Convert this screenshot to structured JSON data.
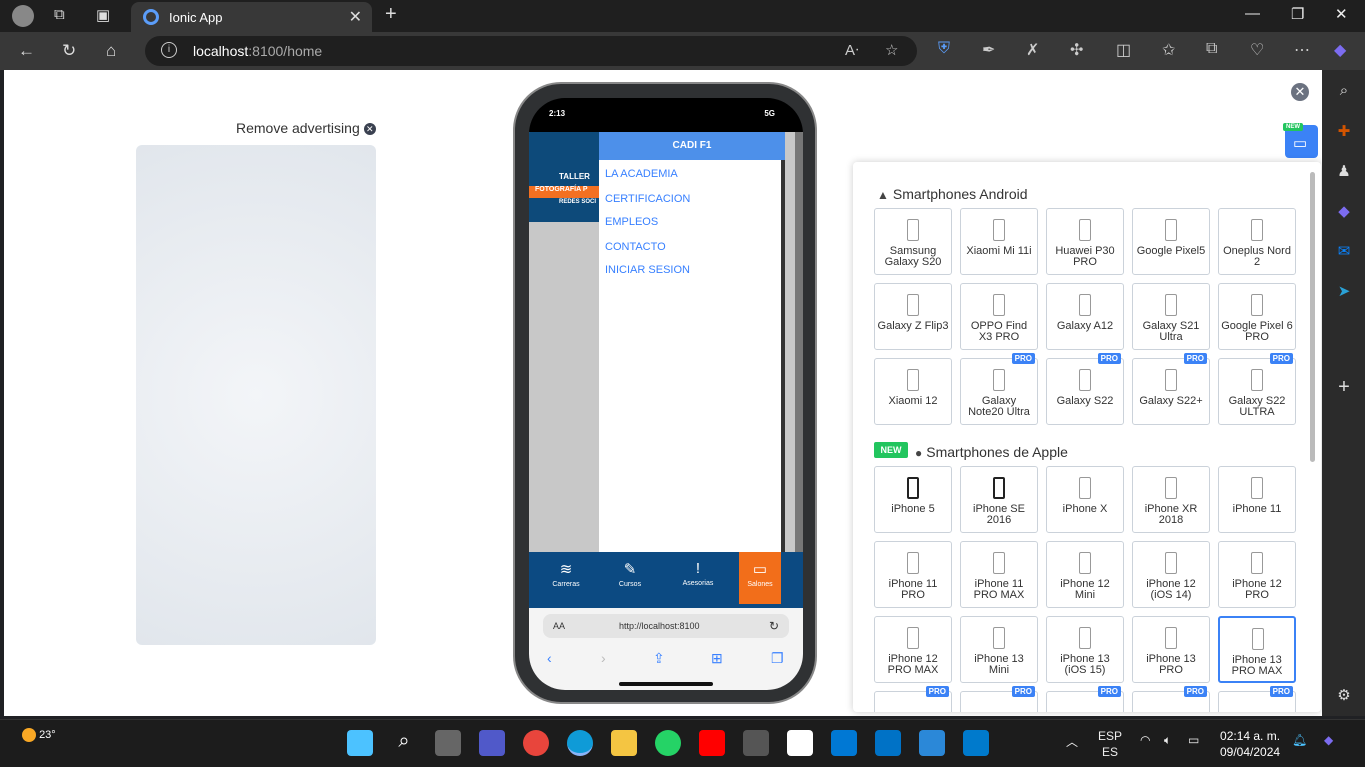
{
  "browser": {
    "tab_title": "Ionic App",
    "url_host": "localhost",
    "url_rest": ":8100/home"
  },
  "ad": {
    "remove_label": "Remove advertising",
    "close_glyph": "✕"
  },
  "phone": {
    "time": "2:13",
    "signal": "5G",
    "banner_text_1": "TALLER",
    "banner_text_2": "FOTOGRAFÍA P",
    "banner_text_3": "REDES SOCI",
    "menu_title": "CADI F1",
    "menu_items": [
      "LA ACADEMIA",
      "CERTIFICACION",
      "EMPLEOS",
      "CONTACTO",
      "INICIAR SESION"
    ],
    "tabs": [
      {
        "label": "Carreras",
        "icon": "≋"
      },
      {
        "label": "Cursos",
        "icon": "✎"
      },
      {
        "label": "Asesorias",
        "icon": "!"
      },
      {
        "label": "Salones",
        "icon": "▭"
      }
    ],
    "safari_aa": "AA",
    "safari_url": "http://localhost:8100"
  },
  "panel": {
    "android_header": "Smartphones Android",
    "apple_header": "Smartphones de Apple",
    "new_badge": "NEW",
    "pro_badge": "PRO",
    "android_devices": [
      "Samsung Galaxy S20",
      "Xiaomi Mi 11i",
      "Huawei P30 PRO",
      "Google Pixel5",
      "Oneplus Nord 2",
      "Galaxy Z Flip3",
      "OPPO Find X3 PRO",
      "Galaxy A12",
      "Galaxy S21 Ultra",
      "Google Pixel 6 PRO",
      "Xiaomi 12",
      "Galaxy Note20 Ultra",
      "Galaxy S22",
      "Galaxy S22+",
      "Galaxy S22 ULTRA"
    ],
    "apple_devices": [
      "iPhone 5",
      "iPhone SE 2016",
      "iPhone X",
      "iPhone XR 2018",
      "iPhone 11",
      "iPhone 11 PRO",
      "iPhone 11 PRO MAX",
      "iPhone 12 Mini",
      "iPhone 12 (iOS 14)",
      "iPhone 12 PRO",
      "iPhone 12 PRO MAX",
      "iPhone 13 Mini",
      "iPhone 13 (iOS 15)",
      "iPhone 13 PRO",
      "iPhone 13 PRO MAX"
    ]
  },
  "taskbar": {
    "temperature": "23°",
    "lang_1": "ESP",
    "lang_2": "ES",
    "time": "02:14 a. m.",
    "date": "09/04/2024"
  },
  "colors": {
    "accent": "#3b82f6",
    "new": "#22c55e",
    "active_tab": "#f26e1a",
    "app_tabbar": "#0c4a82"
  }
}
